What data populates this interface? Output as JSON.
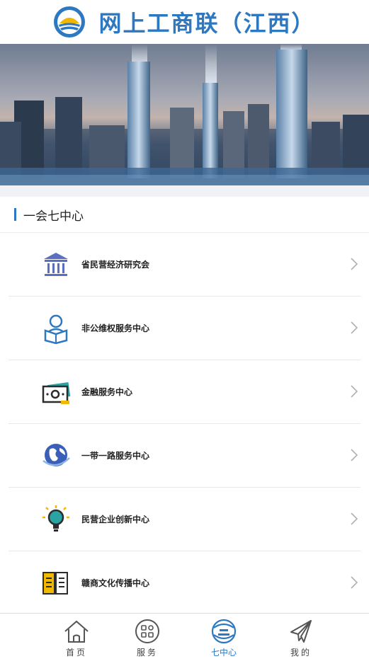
{
  "header": {
    "title": "网上工商联（江西）",
    "logo_icon": "federation-logo-icon"
  },
  "banner": {
    "image": "city-skyline-banner"
  },
  "section": {
    "title": "一会七中心"
  },
  "items": [
    {
      "label": "省民营经济研究会",
      "icon": "institution-building-icon"
    },
    {
      "label": "非公维权服务中心",
      "icon": "person-reading-icon"
    },
    {
      "label": "金融服务中心",
      "icon": "banknote-icon"
    },
    {
      "label": "一带一路服务中心",
      "icon": "globe-icon"
    },
    {
      "label": "民营企业创新中心",
      "icon": "lightbulb-icon"
    },
    {
      "label": "赣商文化传播中心",
      "icon": "open-book-icon"
    }
  ],
  "tabbar": {
    "tabs": [
      {
        "label": "首页",
        "icon": "home-icon"
      },
      {
        "label": "服务",
        "icon": "services-grid-icon"
      },
      {
        "label": "七中心",
        "icon": "seven-centers-icon",
        "active": true
      },
      {
        "label": "我的",
        "icon": "profile-plane-icon"
      }
    ]
  },
  "colors": {
    "accent": "#2e78c2",
    "icon_yellow": "#f2b800",
    "divider": "#e8e8e8",
    "gap": "#f1f2f5"
  }
}
